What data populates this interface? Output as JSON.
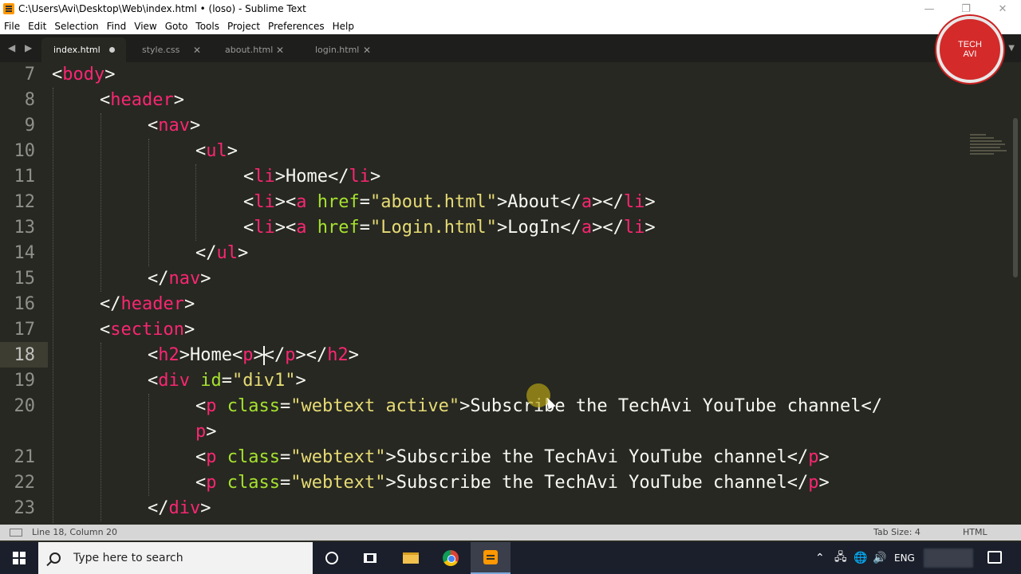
{
  "window": {
    "title": "C:\\Users\\Avi\\Desktop\\Web\\index.html • (loso) - Sublime Text",
    "minimize": "—",
    "restore": "❐",
    "close": "✕"
  },
  "menu": [
    "File",
    "Edit",
    "Selection",
    "Find",
    "View",
    "Goto",
    "Tools",
    "Project",
    "Preferences",
    "Help"
  ],
  "nav_arrows": "◀ ▶",
  "tabs": [
    {
      "label": "index.html",
      "active": true,
      "dirty": true
    },
    {
      "label": "style.css",
      "active": false,
      "close": "✕"
    },
    {
      "label": "about.html",
      "active": false,
      "close": "✕"
    },
    {
      "label": "login.html",
      "active": false,
      "close": "✕"
    }
  ],
  "tab_dropdown": "▼",
  "logo": {
    "line1": "TECH",
    "line2": "AVI"
  },
  "editor": {
    "line_numbers": [
      "7",
      "8",
      "9",
      "10",
      "11",
      "12",
      "13",
      "14",
      "15",
      "16",
      "17",
      "18",
      "19",
      "20",
      "",
      "21",
      "22",
      "23"
    ],
    "current_line": "18"
  },
  "status": {
    "position": "Line 18, Column 20",
    "tab_size": "Tab Size: 4",
    "syntax": "HTML"
  },
  "taskbar": {
    "search_placeholder": "Type here to search",
    "language": "ENG",
    "tray_chevron": "⌃",
    "tray_network": "🖧",
    "tray_globe": "🌐",
    "tray_volume": "🔊"
  },
  "colors": {
    "background": "#272822",
    "tag": "#f92672",
    "attribute": "#a6e22e",
    "string": "#e6db74",
    "text": "#f8f8f2",
    "gutter": "#90908a",
    "line_highlight": "#3e3d32"
  }
}
